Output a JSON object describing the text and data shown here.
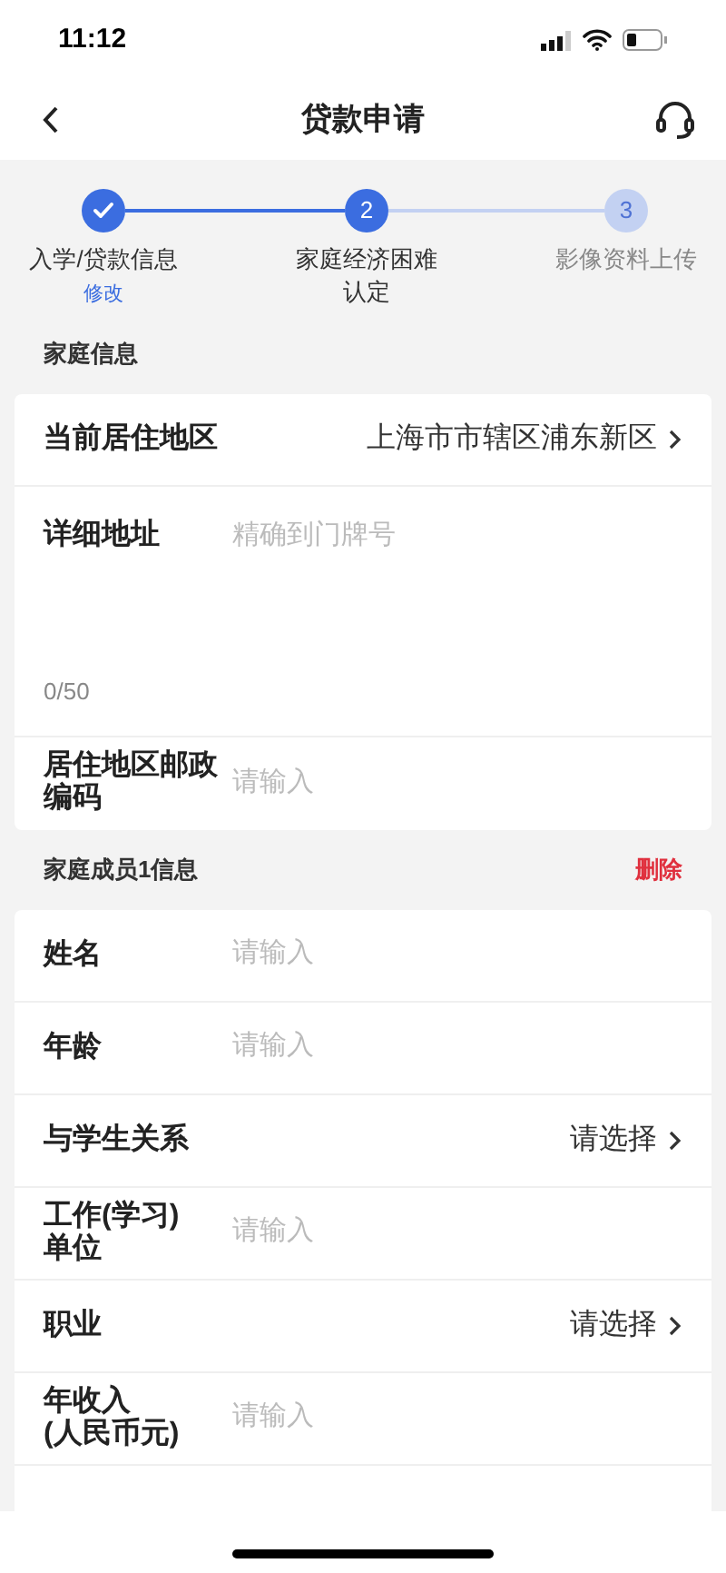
{
  "status_bar": {
    "time": "11:12"
  },
  "nav": {
    "title": "贷款申请"
  },
  "steps": [
    {
      "kind": "done",
      "label": "入学/贷款信息",
      "link": "修改"
    },
    {
      "kind": "current",
      "number": "2",
      "label": "家庭经济困难认定"
    },
    {
      "kind": "pending",
      "number": "3",
      "label": "影像资料上传"
    }
  ],
  "sections": [
    {
      "title": "家庭信息",
      "rows": [
        {
          "kind": "select",
          "label": "当前居住地区",
          "value": "上海市市辖区浦东新区"
        },
        {
          "kind": "textarea",
          "label": "详细地址",
          "placeholder": "精确到门牌号",
          "counter": "0/50"
        },
        {
          "kind": "input",
          "label": "居住地区邮政编码",
          "placeholder": "请输入"
        }
      ]
    },
    {
      "title": "家庭成员1信息",
      "action": "删除",
      "rows": [
        {
          "kind": "input",
          "label": "姓名",
          "placeholder": "请输入"
        },
        {
          "kind": "input",
          "label": "年龄",
          "placeholder": "请输入"
        },
        {
          "kind": "select",
          "label": "与学生关系",
          "value": "请选择"
        },
        {
          "kind": "input",
          "label": "工作(学习)单位",
          "placeholder": "请输入"
        },
        {
          "kind": "select",
          "label": "职业",
          "value": "请选择"
        },
        {
          "kind": "input",
          "label": "年收入(人民币元)",
          "placeholder": "请输入"
        }
      ]
    }
  ]
}
